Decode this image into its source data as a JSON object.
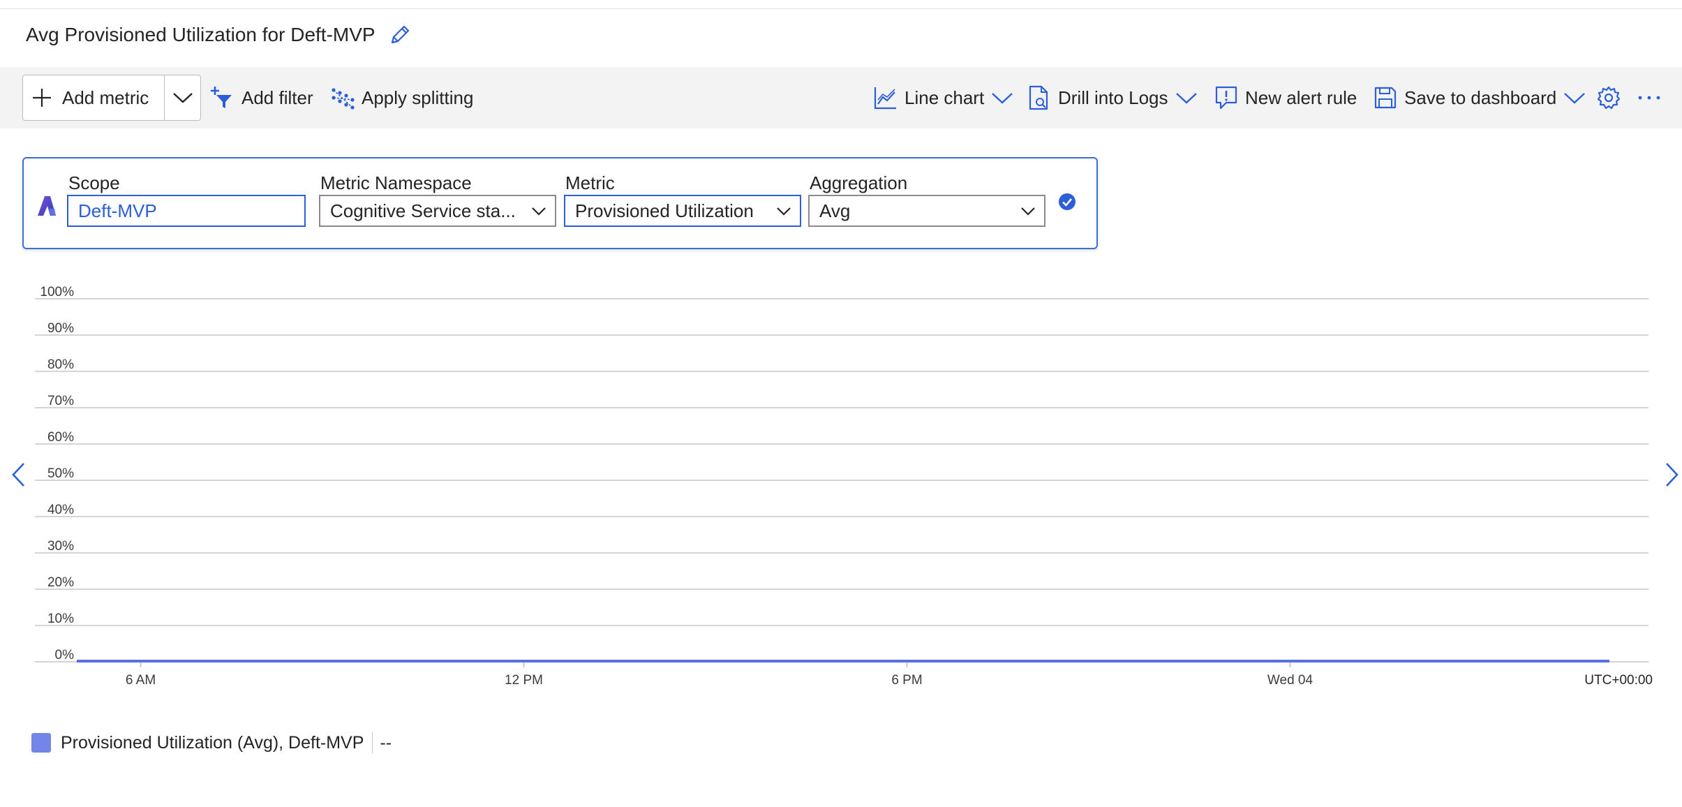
{
  "title": "Avg Provisioned Utilization for Deft-MVP",
  "toolbar": {
    "add_metric": "Add metric",
    "add_filter": "Add filter",
    "apply_splitting": "Apply splitting",
    "line_chart": "Line chart",
    "drill_into_logs": "Drill into Logs",
    "new_alert_rule": "New alert rule",
    "save_to_dashboard": "Save to dashboard",
    "more": "···"
  },
  "metric_selector": {
    "scope_label": "Scope",
    "scope_value": "Deft-MVP",
    "namespace_label": "Metric Namespace",
    "namespace_value": "Cognitive Service sta...",
    "metric_label": "Metric",
    "metric_value": "Provisioned Utilization",
    "aggregation_label": "Aggregation",
    "aggregation_value": "Avg"
  },
  "colors": {
    "accent": "#2b5fd9",
    "series": "#5b6fe0",
    "gridline": "#d4d4d4"
  },
  "chart_data": {
    "type": "line",
    "y_ticks": [
      "100%",
      "90%",
      "80%",
      "70%",
      "60%",
      "50%",
      "40%",
      "30%",
      "20%",
      "10%",
      "0%"
    ],
    "ylim": [
      0,
      100
    ],
    "x_ticks": [
      "6 AM",
      "12 PM",
      "6 PM",
      "Wed 04"
    ],
    "timezone_label": "UTC+00:00",
    "series": [
      {
        "name": "Provisioned Utilization (Avg), Deft-MVP",
        "x": [
          "5 AM",
          "Wed 04 5 AM"
        ],
        "values": [
          0,
          0
        ]
      }
    ],
    "grid": true,
    "legend": "bottom-left"
  },
  "legend": {
    "label": "Provisioned Utilization (Avg), Deft-MVP",
    "value": "--"
  }
}
